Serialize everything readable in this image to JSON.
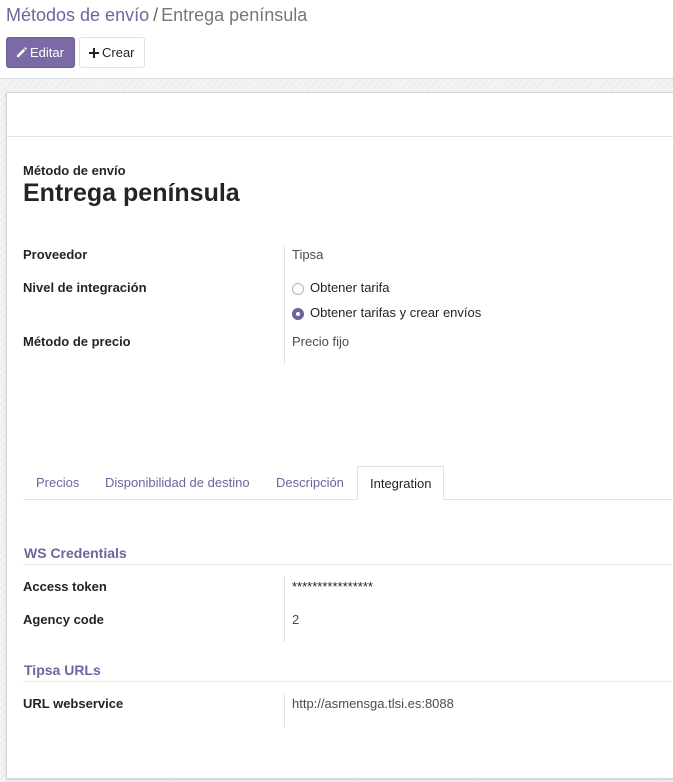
{
  "breadcrumb": {
    "parent": "Métodos de envío",
    "separator": "/",
    "current": "Entrega península"
  },
  "toolbar": {
    "edit_label": "Editar",
    "create_label": "Crear"
  },
  "record": {
    "title_label": "Método de envío",
    "title": "Entrega península"
  },
  "fields": {
    "provider": {
      "label": "Proveedor",
      "value": "Tipsa"
    },
    "integration_level": {
      "label": "Nivel de integración",
      "options": [
        {
          "label": "Obtener tarifa",
          "selected": false
        },
        {
          "label": "Obtener tarifas y crear envíos",
          "selected": true
        }
      ]
    },
    "price_method": {
      "label": "Método de precio",
      "value": "Precio fijo"
    }
  },
  "tabs": [
    {
      "label": "Precios",
      "active": false
    },
    {
      "label": "Disponibilidad de destino",
      "active": false
    },
    {
      "label": "Descripción",
      "active": false
    },
    {
      "label": "Integration",
      "active": true
    }
  ],
  "integration": {
    "ws_credentials": {
      "title": "WS Credentials",
      "access_token": {
        "label": "Access token",
        "value": "****************"
      },
      "agency_code": {
        "label": "Agency code",
        "value": "2"
      }
    },
    "tipsa_urls": {
      "title": "Tipsa URLs",
      "url_webservice": {
        "label": "URL webservice",
        "value": "http://asmensga.tlsi.es:8088"
      }
    }
  },
  "colors": {
    "accent": "#71639e",
    "primary_button": "#7c6aa6",
    "border": "#dee2e6"
  }
}
